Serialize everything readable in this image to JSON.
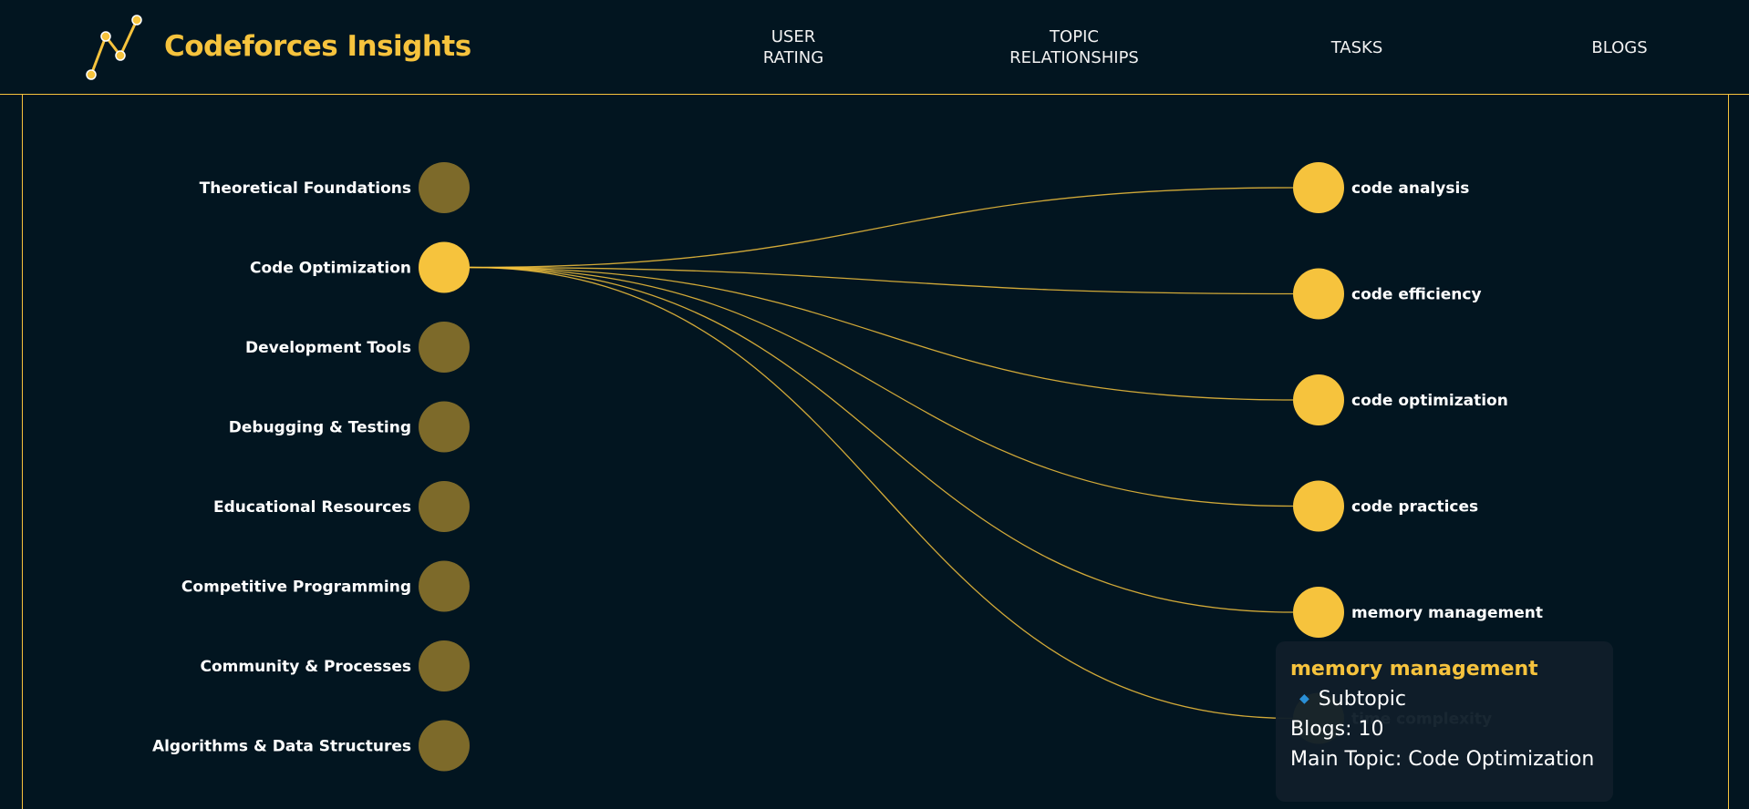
{
  "header": {
    "brand": "Codeforces Insights",
    "nav": [
      {
        "line1": "USER",
        "line2": "RATING"
      },
      {
        "line1": "TOPIC",
        "line2": "RELATIONSHIPS"
      },
      {
        "line1": "TASKS",
        "line2": ""
      },
      {
        "line1": "BLOGS",
        "line2": ""
      }
    ]
  },
  "colors": {
    "accent": "#f6c33d",
    "dimmed_node": "#7d6a2a",
    "background": "#021520"
  },
  "topics": [
    {
      "label": "Theoretical Foundations",
      "selected": false
    },
    {
      "label": "Code Optimization",
      "selected": true
    },
    {
      "label": "Development Tools",
      "selected": false
    },
    {
      "label": "Debugging & Testing",
      "selected": false
    },
    {
      "label": "Educational Resources",
      "selected": false
    },
    {
      "label": "Competitive Programming",
      "selected": false
    },
    {
      "label": "Community & Processes",
      "selected": false
    },
    {
      "label": "Algorithms & Data Structures",
      "selected": false
    }
  ],
  "subtopics": [
    {
      "label": "code analysis"
    },
    {
      "label": "code efficiency"
    },
    {
      "label": "code optimization"
    },
    {
      "label": "code practices"
    },
    {
      "label": "memory management"
    },
    {
      "label": "time complexity"
    }
  ],
  "tooltip": {
    "title": "memory management",
    "type": "Subtopic",
    "blogs": "Blogs: 10",
    "main_topic": "Main Topic: Code Optimization",
    "icon": "diamond-icon"
  }
}
